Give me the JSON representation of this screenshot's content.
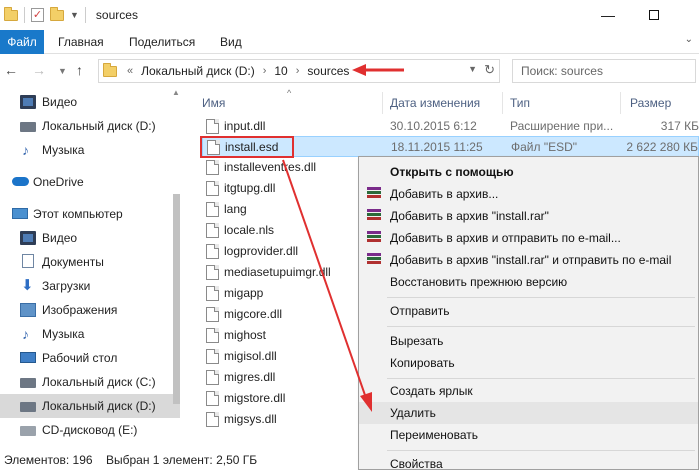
{
  "window": {
    "title": "sources",
    "min_glyph": "—",
    "max_glyph": ""
  },
  "ribbon": {
    "tabs": [
      "Файл",
      "Главная",
      "Поделиться",
      "Вид"
    ]
  },
  "address": {
    "prefix": "«",
    "crumbs": [
      "Локальный диск (D:)",
      "10",
      "sources"
    ],
    "separator": "›",
    "search_placeholder": "Поиск: sources"
  },
  "navpane": {
    "items": [
      {
        "label": "Видео",
        "icon": "video-icon"
      },
      {
        "label": "Локальный диск (D:)",
        "icon": "drive-icon"
      },
      {
        "label": "Музыка",
        "icon": "music-icon"
      },
      {
        "label": "OneDrive",
        "icon": "onedrive-icon"
      },
      {
        "label": "Этот компьютер",
        "icon": "computer-icon"
      },
      {
        "label": "Видео",
        "icon": "video-icon"
      },
      {
        "label": "Документы",
        "icon": "documents-icon"
      },
      {
        "label": "Загрузки",
        "icon": "downloads-icon"
      },
      {
        "label": "Изображения",
        "icon": "pictures-icon"
      },
      {
        "label": "Музыка",
        "icon": "music-icon"
      },
      {
        "label": "Рабочий стол",
        "icon": "desktop-icon"
      },
      {
        "label": "Локальный диск (C:)",
        "icon": "drive-icon"
      },
      {
        "label": "Локальный диск (D:)",
        "icon": "drive-icon",
        "selected": true
      },
      {
        "label": "CD-дисковод (E:)",
        "icon": "cd-drive-icon"
      }
    ]
  },
  "filelist": {
    "columns": [
      "Имя",
      "Дата изменения",
      "Тип",
      "Размер"
    ],
    "files": [
      {
        "name": "input.dll",
        "date": "30.10.2015 6:12",
        "type": "Расширение при...",
        "size": "317 КБ"
      },
      {
        "name": "install.esd",
        "date": "18.11.2015 11:25",
        "type": "Файл \"ESD\"",
        "size": "2 622 280 КБ",
        "selected": true
      },
      {
        "name": "installeventres.dll",
        "date": "",
        "type": "",
        "size": ""
      },
      {
        "name": "itgtupg.dll",
        "date": "",
        "type": "",
        "size": ""
      },
      {
        "name": "lang",
        "date": "",
        "type": "",
        "size": ""
      },
      {
        "name": "locale.nls",
        "date": "",
        "type": "",
        "size": ""
      },
      {
        "name": "logprovider.dll",
        "date": "",
        "type": "",
        "size": ""
      },
      {
        "name": "mediasetupuimgr.dll",
        "date": "",
        "type": "",
        "size": ""
      },
      {
        "name": "migapp",
        "date": "",
        "type": "",
        "size": ""
      },
      {
        "name": "migcore.dll",
        "date": "",
        "type": "",
        "size": ""
      },
      {
        "name": "mighost",
        "date": "",
        "type": "",
        "size": ""
      },
      {
        "name": "migisol.dll",
        "date": "",
        "type": "",
        "size": ""
      },
      {
        "name": "migres.dll",
        "date": "",
        "type": "",
        "size": ""
      },
      {
        "name": "migstore.dll",
        "date": "",
        "type": "",
        "size": ""
      },
      {
        "name": "migsys.dll",
        "date": "",
        "type": "",
        "size": ""
      }
    ]
  },
  "context_menu": {
    "items": [
      {
        "label": "Открыть с помощью",
        "bold": true
      },
      {
        "label": "Добавить в архив...",
        "rar": true
      },
      {
        "label": "Добавить в архив \"install.rar\"",
        "rar": true
      },
      {
        "label": "Добавить в архив и отправить по e-mail...",
        "rar": true
      },
      {
        "label": "Добавить в архив \"install.rar\" и отправить по e-mail",
        "rar": true
      },
      {
        "label": "Восстановить прежнюю версию"
      },
      {
        "label": "Отправить"
      },
      {
        "label": "Вырезать"
      },
      {
        "label": "Копировать"
      },
      {
        "label": "Создать ярлык"
      },
      {
        "label": "Удалить",
        "hover": true
      },
      {
        "label": "Переименовать"
      },
      {
        "label": "Свойства"
      }
    ]
  },
  "status": {
    "count": "Элементов: 196",
    "selected": "Выбран 1 элемент: 2,50 ГБ"
  },
  "colors": {
    "accent": "#1979ca",
    "annotation_red": "#e03030",
    "selection": "#cce8ff"
  }
}
